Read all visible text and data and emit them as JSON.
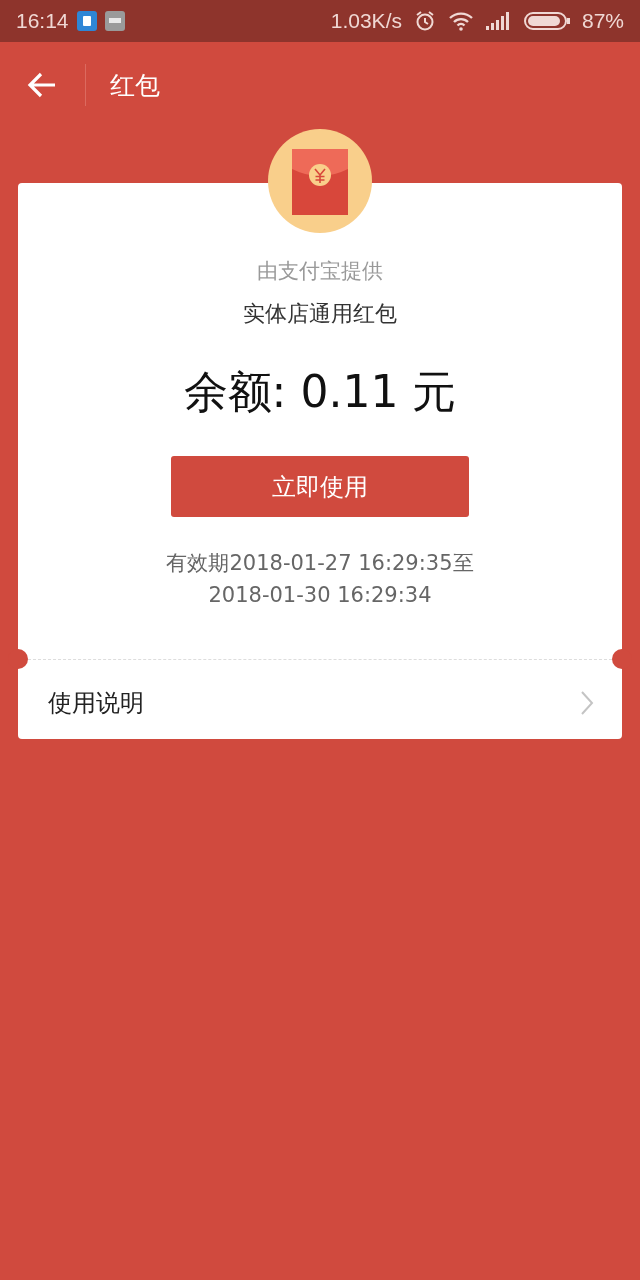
{
  "status_bar": {
    "time": "16:14",
    "speed": "1.03K/s",
    "battery": "87%"
  },
  "app_bar": {
    "title": "红包"
  },
  "card": {
    "provider": "由支付宝提供",
    "name": "实体店通用红包",
    "balance": "余额: 0.11 元",
    "button": "立即使用",
    "validity": "有效期2018-01-27 16:29:35至 2018-01-30 16:29:34",
    "instructions": "使用说明"
  }
}
